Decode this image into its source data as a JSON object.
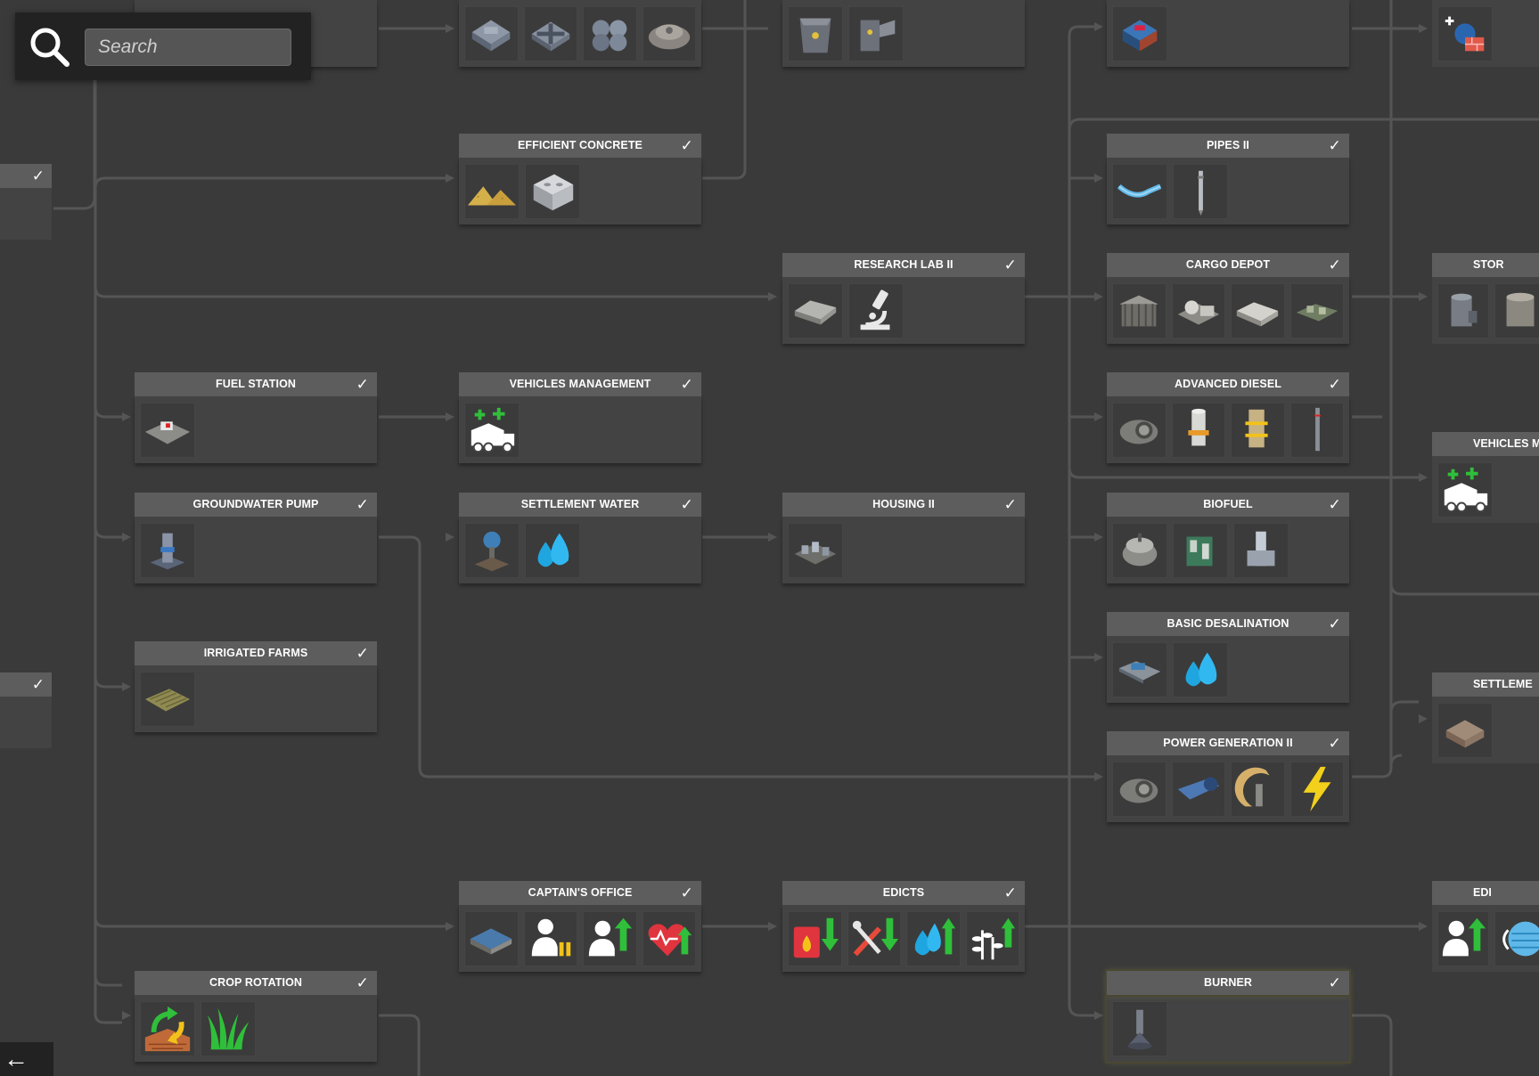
{
  "search": {
    "placeholder": "Search"
  },
  "nodes": {
    "efficient_concrete": {
      "title": "EFFICIENT CONCRETE",
      "check": "✓"
    },
    "pipes_ii": {
      "title": "PIPES II",
      "check": "✓"
    },
    "research_lab_ii": {
      "title": "RESEARCH LAB II",
      "check": "✓"
    },
    "cargo_depot": {
      "title": "CARGO DEPOT",
      "check": "✓"
    },
    "fuel_station": {
      "title": "FUEL STATION",
      "check": "✓"
    },
    "vehicles_management": {
      "title": "VEHICLES MANAGEMENT",
      "check": "✓"
    },
    "advanced_diesel": {
      "title": "ADVANCED DIESEL",
      "check": "✓"
    },
    "groundwater_pump": {
      "title": "GROUNDWATER PUMP",
      "check": "✓"
    },
    "settlement_water": {
      "title": "SETTLEMENT WATER",
      "check": "✓"
    },
    "housing_ii": {
      "title": "HOUSING II",
      "check": "✓"
    },
    "biofuel": {
      "title": "BIOFUEL",
      "check": "✓"
    },
    "basic_desalination": {
      "title": "BASIC DESALINATION",
      "check": "✓"
    },
    "irrigated_farms": {
      "title": "IRRIGATED FARMS",
      "check": "✓"
    },
    "power_generation_ii": {
      "title": "POWER GENERATION II",
      "check": "✓"
    },
    "captains_office": {
      "title": "CAPTAIN'S OFFICE",
      "check": "✓"
    },
    "edicts": {
      "title": "EDICTS",
      "check": "✓"
    },
    "crop_rotation": {
      "title": "CROP ROTATION",
      "check": "✓"
    },
    "burner": {
      "title": "BURNER",
      "check": "✓"
    }
  },
  "partial_nodes": {
    "stor": {
      "title": "STOR"
    },
    "vehicles_m": {
      "title": "VEHICLES M"
    },
    "settleme": {
      "title": "SETTLEME"
    },
    "edi": {
      "title": "EDI"
    }
  },
  "left_stubs": {
    "check": "✓"
  },
  "back_button": {
    "label": "←"
  },
  "colors": {
    "background": "#3a3a3a",
    "header": "#5d5d5d",
    "body": "#434343",
    "line": "#555555",
    "accent_green": "#2fbf3a",
    "accent_blue": "#1fa6e0",
    "accent_yellow": "#f2c21b"
  }
}
